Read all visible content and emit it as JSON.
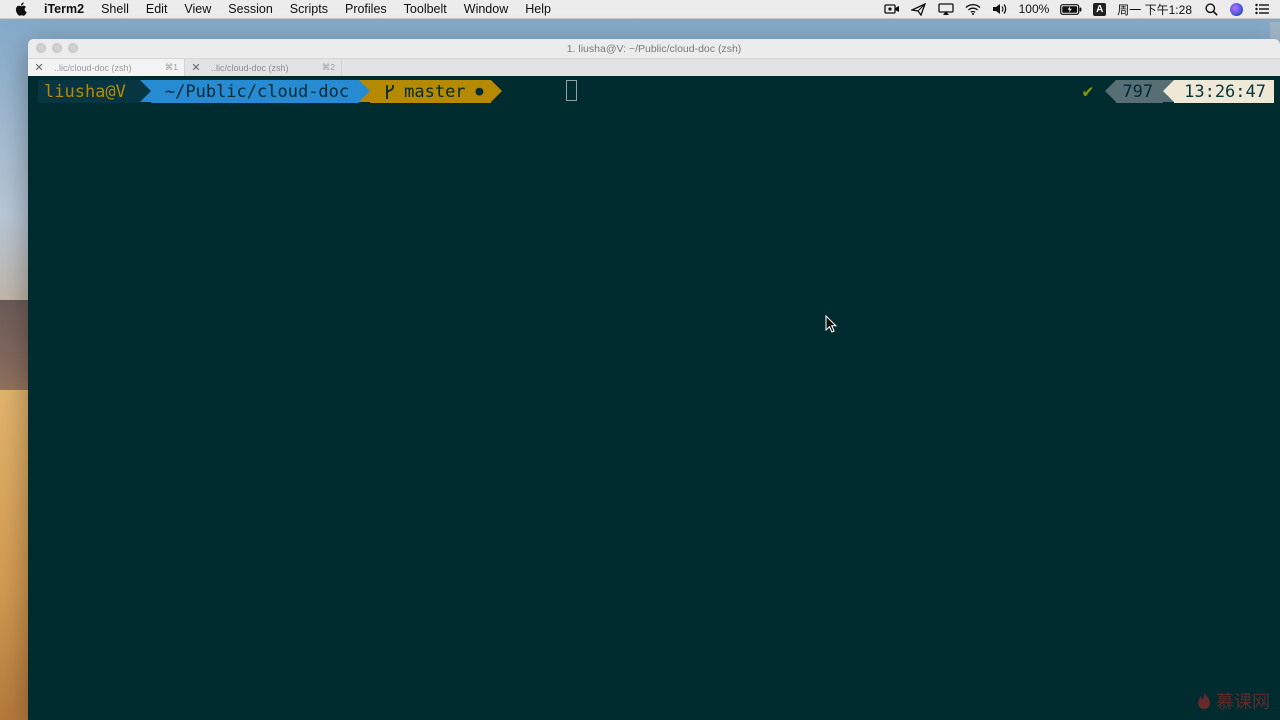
{
  "menubar": {
    "apple_icon": "apple-icon",
    "items": [
      "iTerm2",
      "Shell",
      "Edit",
      "View",
      "Session",
      "Scripts",
      "Profiles",
      "Toolbelt",
      "Window",
      "Help"
    ],
    "status": {
      "battery_percent": "100%",
      "input_method": "A",
      "datetime": "周一 下午1:28"
    }
  },
  "window": {
    "title": "1. liusha@V: ~/Public/cloud-doc (zsh)",
    "tabs": [
      {
        "label": "..lic/cloud-doc (zsh)",
        "shortcut": "⌘1",
        "active": true
      },
      {
        "label": "..lic/cloud-doc (zsh)",
        "shortcut": "⌘2",
        "active": false
      }
    ]
  },
  "terminal": {
    "prompt": {
      "user_host": "liusha@V",
      "path": "~/Public/cloud-doc",
      "branch": "master",
      "dirty_marker": "●"
    },
    "right_prompt": {
      "status": "✔",
      "history_number": "797",
      "time": "13:26:47"
    }
  },
  "watermark": {
    "text": "慕课网"
  },
  "colors": {
    "terminal_bg": "#002b2f",
    "user_segment": "#073642",
    "path_segment": "#268bd2",
    "git_segment": "#b58900",
    "status_ok": "#859900",
    "time_segment": "#eee8d5"
  }
}
